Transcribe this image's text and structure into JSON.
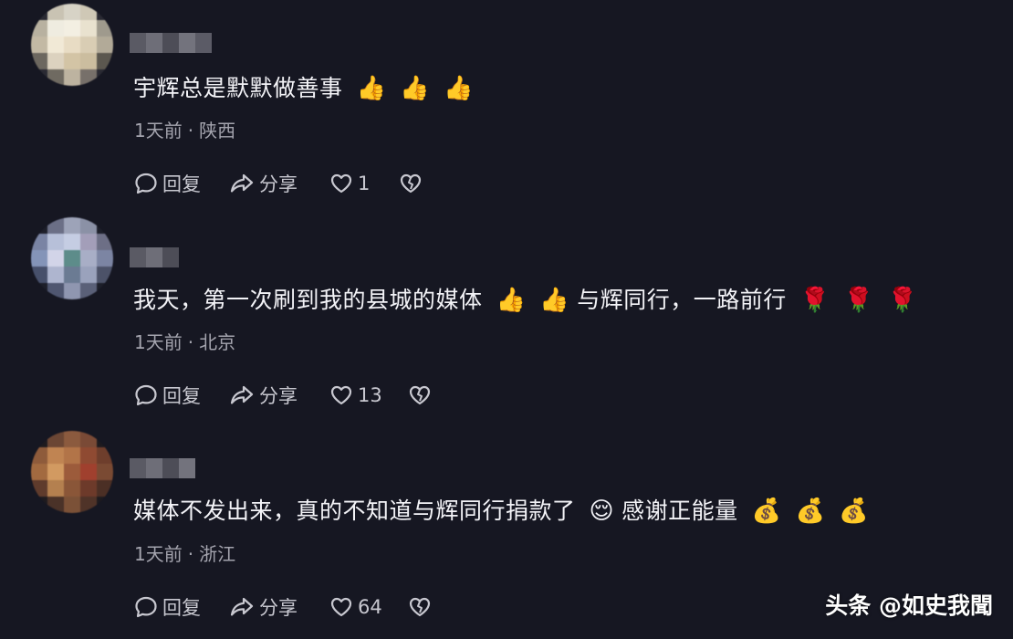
{
  "comments": [
    {
      "text": "宇辉总是默默做善事",
      "emojis": [
        "👍",
        "👍",
        "👍"
      ],
      "time": "1天前",
      "location": "陕西",
      "reply_label": "回复",
      "share_label": "分享",
      "likes": "1"
    },
    {
      "text": "我天，第一次刷到我的县城的媒体",
      "emojis": [
        "👍",
        "👍"
      ],
      "text2": "与辉同行，一路前行",
      "emojis2": [
        "🌹",
        "🌹",
        "🌹"
      ],
      "time": "1天前",
      "location": "北京",
      "reply_label": "回复",
      "share_label": "分享",
      "likes": "13"
    },
    {
      "text": "媒体不发出来，真的不知道与辉同行捐款了",
      "emojis": [
        "😌"
      ],
      "text2": "感谢正能量",
      "emojis2": [
        "💰",
        "💰",
        "💰"
      ],
      "time": "1天前",
      "location": "浙江",
      "reply_label": "回复",
      "share_label": "分享",
      "likes": "64"
    }
  ],
  "watermark": "头条 @如史我聞",
  "icons": {
    "reply": "comment-bubble-icon",
    "share": "share-arrow-icon",
    "like": "heart-icon",
    "dislike": "broken-heart-icon"
  },
  "colors": {
    "background": "#161722",
    "text": "#f3f3f7",
    "meta": "#a4a4ae"
  }
}
